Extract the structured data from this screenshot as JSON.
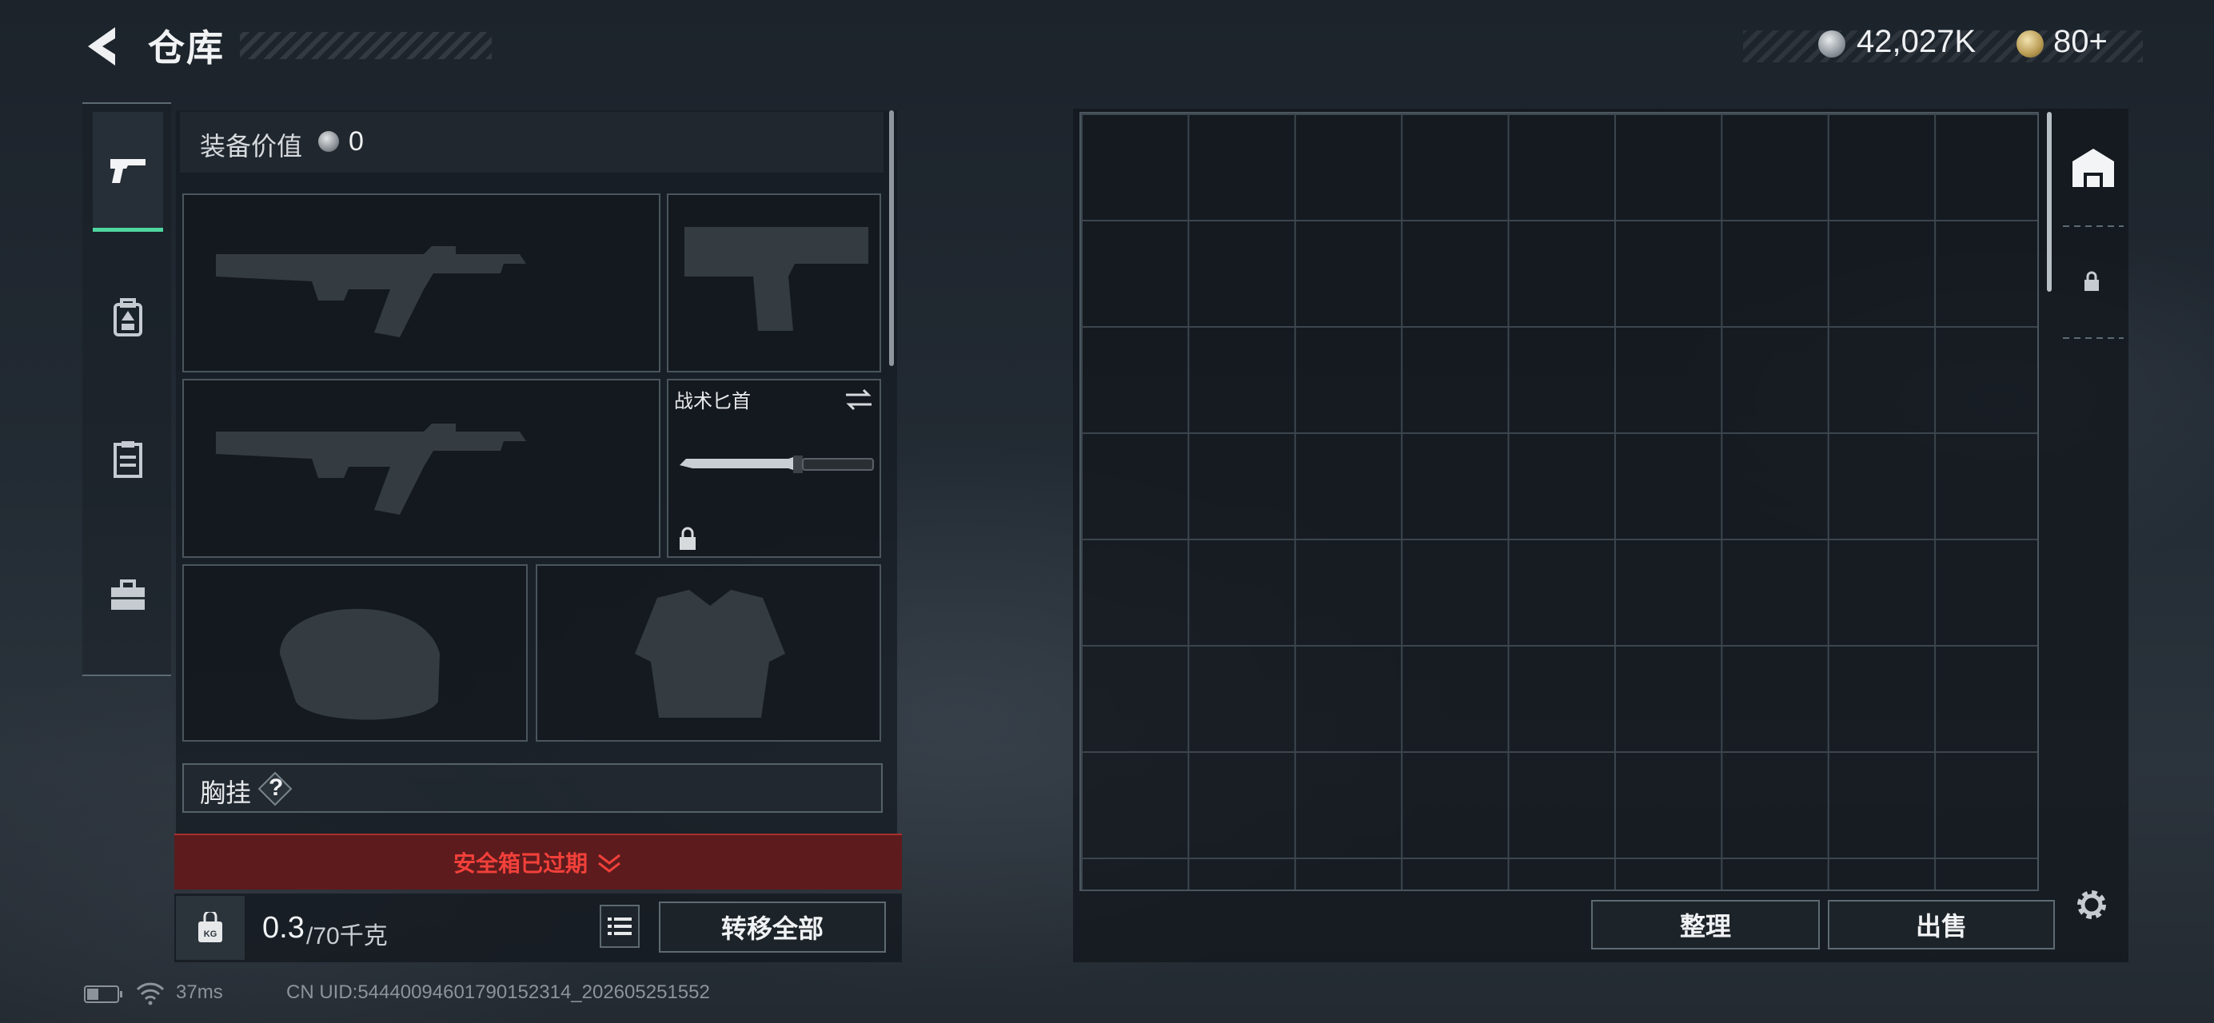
{
  "header": {
    "title": "仓库",
    "currency_silver": "42,027K",
    "currency_gold": "80+"
  },
  "equipment": {
    "value_label": "装备价值",
    "value": "0",
    "knife_name": "战术匕首",
    "chest_rig_label": "胸挂",
    "chest_rig_help": "?",
    "safebox_expired": "安全箱已过期",
    "weight_current": "0.3",
    "weight_max": "/70千克",
    "transfer_all": "转移全部"
  },
  "storage": {
    "sort_label": "整理",
    "sell_label": "出售"
  },
  "status_bar": {
    "ping": "37ms",
    "uid": "CN UID:5444009460179015231​4_202605251552"
  },
  "tabs": [
    "weapon-icon",
    "backpack-icon",
    "rig-icon",
    "toolbox-icon"
  ],
  "colors": {
    "accent": "#4fd6a0",
    "expired_bg": "#5d1b1d",
    "expired_text": "#f2403a"
  }
}
